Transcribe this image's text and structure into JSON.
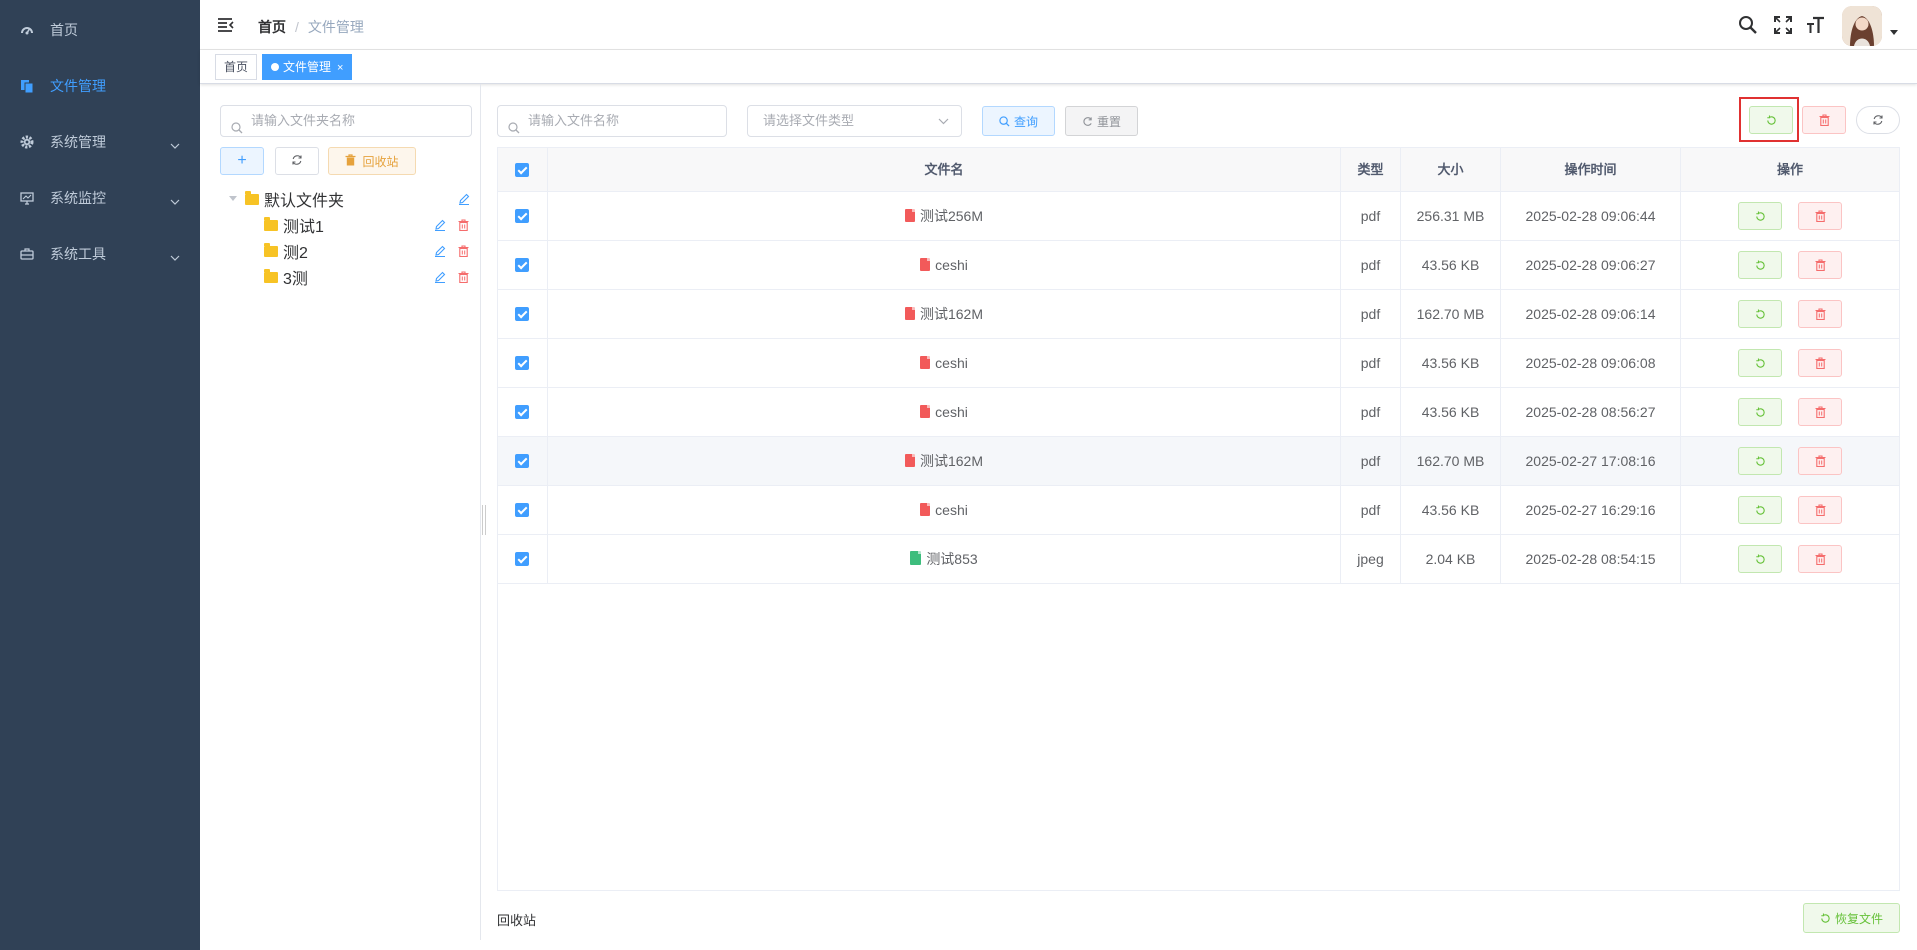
{
  "sidebar": {
    "items": [
      {
        "label": "首页",
        "icon": "dashboard-icon"
      },
      {
        "label": "文件管理",
        "icon": "file-icon"
      },
      {
        "label": "系统管理",
        "icon": "gear-icon"
      },
      {
        "label": "系统监控",
        "icon": "monitor-icon"
      },
      {
        "label": "系统工具",
        "icon": "toolbox-icon"
      }
    ]
  },
  "header": {
    "breadcrumb": {
      "home": "首页",
      "separator": "/",
      "current": "文件管理"
    }
  },
  "tags": {
    "items": [
      {
        "label": "首页"
      },
      {
        "label": "文件管理",
        "close": "×"
      }
    ]
  },
  "left_panel": {
    "folder_search_placeholder": "请输入文件夹名称",
    "add_label": "+",
    "recycle_label": "回收站",
    "tree": {
      "root": "默认文件夹",
      "children": [
        "测试1",
        "测2",
        "3测"
      ]
    }
  },
  "toolbar": {
    "file_search_placeholder": "请输入文件名称",
    "type_select_placeholder": "请选择文件类型",
    "query_label": "查询",
    "reset_label": "重置"
  },
  "table": {
    "columns": [
      "文件名",
      "类型",
      "大小",
      "操作时间",
      "操作"
    ],
    "rows": [
      {
        "name": "测试256M",
        "type": "pdf",
        "size": "256.31 MB",
        "time": "2025-02-28 09:06:44",
        "kind": "pdf"
      },
      {
        "name": "ceshi",
        "type": "pdf",
        "size": "43.56 KB",
        "time": "2025-02-28 09:06:27",
        "kind": "pdf"
      },
      {
        "name": "测试162M",
        "type": "pdf",
        "size": "162.70 MB",
        "time": "2025-02-28 09:06:14",
        "kind": "pdf"
      },
      {
        "name": "ceshi",
        "type": "pdf",
        "size": "43.56 KB",
        "time": "2025-02-28 09:06:08",
        "kind": "pdf"
      },
      {
        "name": "ceshi",
        "type": "pdf",
        "size": "43.56 KB",
        "time": "2025-02-28 08:56:27",
        "kind": "pdf"
      },
      {
        "name": "测试162M",
        "type": "pdf",
        "size": "162.70 MB",
        "time": "2025-02-27 17:08:16",
        "kind": "pdf"
      },
      {
        "name": "ceshi",
        "type": "pdf",
        "size": "43.56 KB",
        "time": "2025-02-27 16:29:16",
        "kind": "pdf"
      },
      {
        "name": "测试853",
        "type": "jpeg",
        "size": "2.04 KB",
        "time": "2025-02-28 08:54:15",
        "kind": "img"
      }
    ]
  },
  "footer": {
    "label": "回收站",
    "restore_label": "恢复文件"
  },
  "colors": {
    "sidebar_bg": "#304156",
    "primary": "#409eff",
    "success": "#67c23a",
    "danger": "#f56c6c",
    "warning": "#e6a23c",
    "highlight": "#e03131"
  }
}
